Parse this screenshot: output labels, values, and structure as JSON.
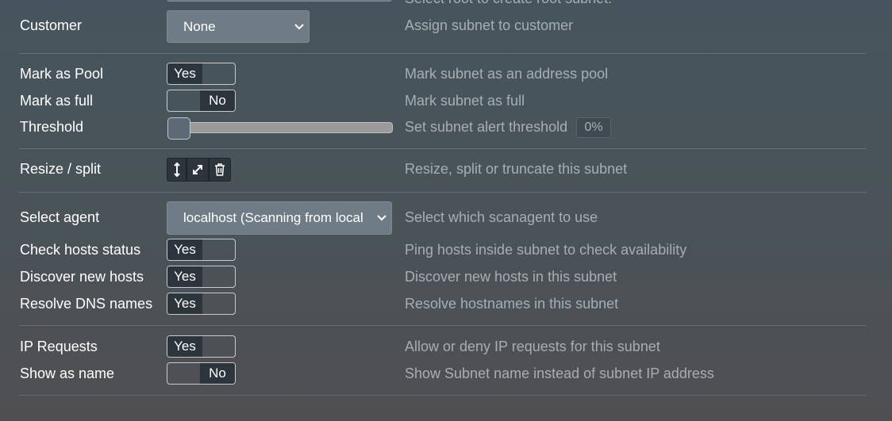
{
  "top_partial": {
    "help": "Select root to create root subnet."
  },
  "customer": {
    "label": "Customer",
    "value": "None",
    "help": "Assign subnet to customer"
  },
  "mark_pool": {
    "label": "Mark as Pool",
    "state": "Yes",
    "help": "Mark subnet as an address pool"
  },
  "mark_full": {
    "label": "Mark as full",
    "state": "No",
    "help": "Mark subnet as full"
  },
  "threshold": {
    "label": "Threshold",
    "value_percent": 0,
    "display": "0%",
    "help": "Set subnet alert threshold"
  },
  "resize": {
    "label": "Resize / split",
    "icons": [
      "resize-vertical-icon",
      "expand-icon",
      "trash-icon"
    ],
    "help": "Resize, split or truncate this subnet"
  },
  "agent": {
    "label": "Select agent",
    "value": "localhost (Scanning from local",
    "help": "Select which scanagent to use"
  },
  "check_hosts": {
    "label": "Check hosts status",
    "state": "Yes",
    "help": "Ping hosts inside subnet to check availability"
  },
  "discover": {
    "label": "Discover new hosts",
    "state": "Yes",
    "help": "Discover new hosts in this subnet"
  },
  "resolve_dns": {
    "label": "Resolve DNS names",
    "state": "Yes",
    "help": "Resolve hostnames in this subnet"
  },
  "ip_requests": {
    "label": "IP Requests",
    "state": "Yes",
    "help": "Allow or deny IP requests for this subnet"
  },
  "show_name": {
    "label": "Show as name",
    "state": "No",
    "help": "Show Subnet name instead of subnet IP address"
  },
  "colors": {
    "toggle_dark": "#2c353b",
    "select_bg": "#6f7c86",
    "help_text": "#a7aeb3"
  }
}
